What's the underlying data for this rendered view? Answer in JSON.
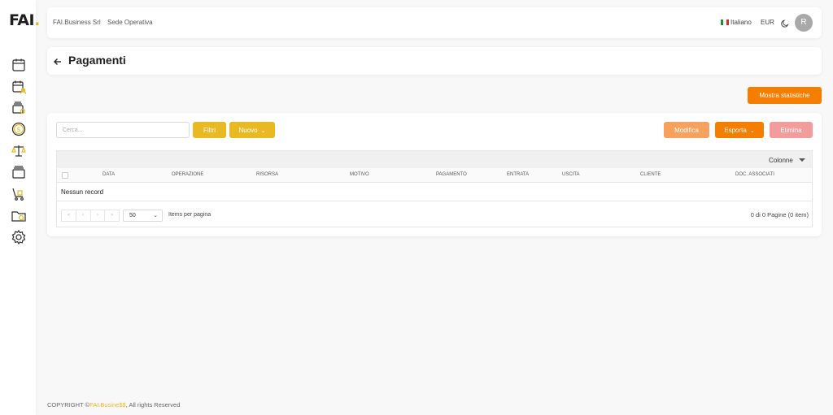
{
  "logo": {
    "text": "FAI",
    "dot": "."
  },
  "sidebar": {
    "items": [
      {
        "icon": "calendar-icon"
      },
      {
        "icon": "calendar-user-icon"
      },
      {
        "icon": "stack-coin-icon"
      },
      {
        "icon": "dollar-coin-icon"
      },
      {
        "icon": "balance-scale-icon"
      },
      {
        "icon": "stack-icon"
      },
      {
        "icon": "trolley-icon"
      },
      {
        "icon": "folder-search-icon"
      },
      {
        "icon": "gear-icon"
      }
    ]
  },
  "header": {
    "company": "FAI.Business Srl",
    "site": "Sede Operativa",
    "language": "Italiano",
    "currency": "EUR",
    "avatar_initial": "R"
  },
  "page": {
    "title": "Pagamenti"
  },
  "toolbar": {
    "stats_button": "Mostra statistiche",
    "search_placeholder": "Cerca...",
    "filters_button": "Filtri",
    "new_button": "Nuovo",
    "edit_button": "Modifica",
    "export_button": "Esporta",
    "delete_button": "Elimina"
  },
  "grid": {
    "columns_button": "Colonne",
    "columns": [
      "DATA",
      "OPERAZIONE",
      "RISORSA",
      "MOTIVO",
      "PAGAMENTO",
      "ENTRATA",
      "USCITA",
      "CLIENTE",
      "DOC. ASSOCIATI"
    ],
    "empty_text": "Nessun record",
    "pager": [
      "«",
      "‹",
      "›",
      "»"
    ],
    "page_size": "50",
    "items_per_page": "Items per pagina",
    "page_info": "0 di 0 Pagine (0 item)"
  },
  "footer": {
    "prefix": "COPYRIGHT ©",
    "brand": "FAI.Busine$$",
    "suffix": ", All rights Reserved"
  },
  "colors": {
    "accent_yellow": "#e8b923",
    "accent_orange": "#f57d00",
    "edit_orange": "#f6a25e",
    "delete_red": "#f39c9c"
  }
}
